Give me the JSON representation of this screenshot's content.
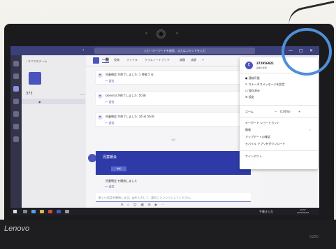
{
  "device": {
    "brand": "Lenovo",
    "model": "X250"
  },
  "titlebar": {
    "search_placeholder": "入力・キーワードを検索、またはコマンドを入力",
    "back_arrow": "‹",
    "minimize": "—",
    "maximize": "□",
    "close": "✕"
  },
  "teams_panel": {
    "back_label": "‹ すべてのチーム",
    "team_name": "373",
    "more": "…"
  },
  "channel": {
    "tabs": [
      "一般",
      "投稿",
      "ファイル",
      "クラスノートブック",
      "課題",
      "成績",
      "+"
    ],
    "messages": [
      {
        "text": "児童朝会 が終了しました: 1 時間 5 分",
        "reply": "↩ 返信"
      },
      {
        "text": "General が終了しました: 50 秒",
        "reply": "↩ 返信"
      },
      {
        "text": "児童朝会 が終了しました: 26 分 56 秒",
        "reply": "↩ 返信"
      }
    ],
    "date_separator": "今日",
    "meeting_card": {
      "title": "児童朝会",
      "button": "参加",
      "subtext": "児童朝会 を開始しました",
      "reply": "↩ 返信"
    },
    "compose_placeholder": "新しい会話を開始します。@を入力して、誰かにメンションしてください。",
    "format_icons": "A ⌕ ☺ ▣ ☰ ▶ ⋯"
  },
  "profile_menu": {
    "avatar": "E",
    "name": "372956921",
    "change": "画像の変更",
    "items_top": [
      "● 連絡可能",
      "✎ ステータスメッセージを設定",
      "☐ 保存済み",
      "⚙ 設定"
    ],
    "zoom_label": "ズーム",
    "zoom_minus": "−",
    "zoom_value": "(100%)",
    "zoom_plus": "+",
    "items_bottom": [
      "キーボード ショートカット",
      "情報",
      "アップデートの確認",
      "モバイル アプリをダウンロード"
    ],
    "about_arrow": "›",
    "signout": "サインアウト"
  },
  "taskbar": {
    "tray": "手書き入力",
    "time": "16:57",
    "date": "2021/03/05"
  },
  "colors": {
    "teams_purple": "#4b53bc",
    "card_blue": "#2e3aa7",
    "titlebar": "#3b3f7a",
    "annotation_circle": "#4f8fd9"
  }
}
